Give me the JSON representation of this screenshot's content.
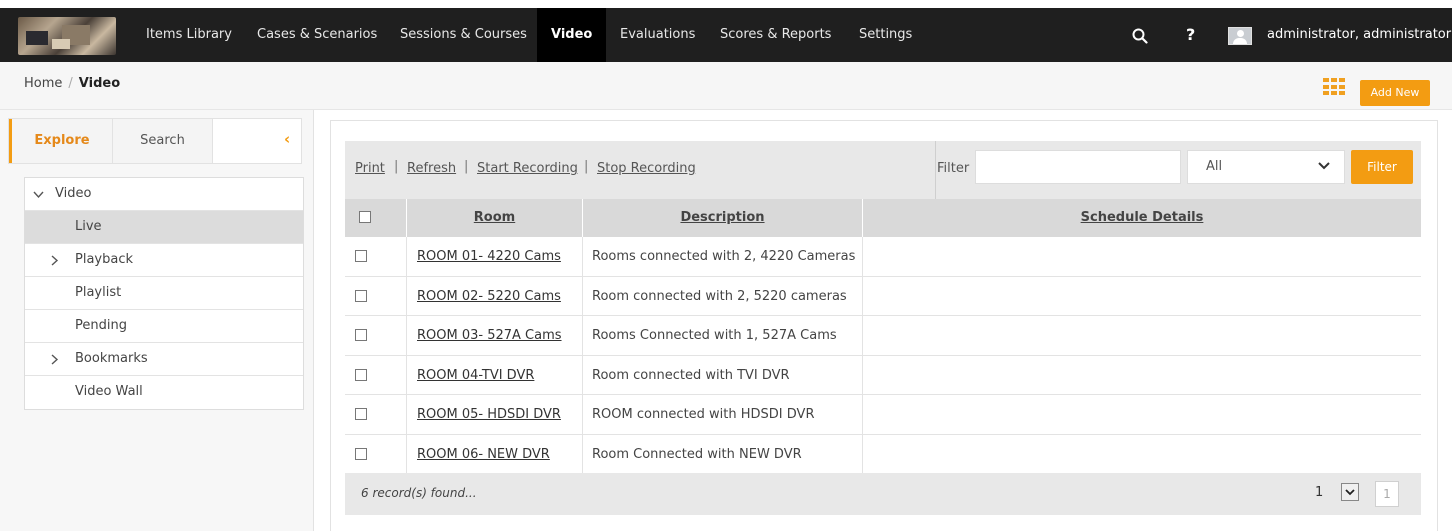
{
  "nav": {
    "items": [
      {
        "label": "Items Library"
      },
      {
        "label": "Cases & Scenarios"
      },
      {
        "label": "Sessions & Courses"
      },
      {
        "label": "Video"
      },
      {
        "label": "Evaluations"
      },
      {
        "label": "Scores & Reports"
      },
      {
        "label": "Settings"
      }
    ],
    "active": "Video",
    "search_icon": "search-icon",
    "help_glyph": "?",
    "user_name": "administrator, administrator"
  },
  "breadcrumb": {
    "home": "Home",
    "sep": "/",
    "current": "Video"
  },
  "actions": {
    "add_new": "Add New",
    "grid_icon": "grid-icon"
  },
  "left": {
    "tabs": {
      "explore": "Explore",
      "search": "Search"
    },
    "tree": [
      {
        "label": "Video"
      },
      {
        "label": "Live"
      },
      {
        "label": "Playback"
      },
      {
        "label": "Playlist"
      },
      {
        "label": "Pending"
      },
      {
        "label": "Bookmarks"
      },
      {
        "label": "Video Wall"
      }
    ]
  },
  "toolbar": {
    "print": "Print",
    "refresh": "Refresh",
    "start_recording": "Start Recording",
    "stop_recording": "Stop Recording",
    "sep": "|",
    "filter_label": "Filter",
    "filter_value": "",
    "filter_select": "All",
    "filter_button": "Filter"
  },
  "table": {
    "headers": {
      "room": "Room",
      "description": "Description",
      "schedule": "Schedule Details"
    },
    "rows": [
      {
        "room": "ROOM 01- 4220 Cams",
        "description": "Rooms connected with 2, 4220 Cameras",
        "schedule": ""
      },
      {
        "room": "ROOM 02- 5220 Cams",
        "description": "Room connected with 2, 5220 cameras",
        "schedule": ""
      },
      {
        "room": "ROOM 03- 527A Cams",
        "description": "Rooms Connected with 1, 527A Cams",
        "schedule": ""
      },
      {
        "room": "ROOM 04-TVI DVR",
        "description": "Room connected with TVI DVR",
        "schedule": ""
      },
      {
        "room": "ROOM 05- HDSDI DVR",
        "description": "ROOM connected with HDSDI DVR",
        "schedule": ""
      },
      {
        "room": "ROOM 06- NEW DVR",
        "description": "Room Connected with NEW DVR",
        "schedule": ""
      }
    ]
  },
  "footer": {
    "records": "6 record(s) found...",
    "page": "1",
    "page_box": "1"
  },
  "colors": {
    "accent": "#f39c12",
    "topbar": "#1f1f1f"
  }
}
